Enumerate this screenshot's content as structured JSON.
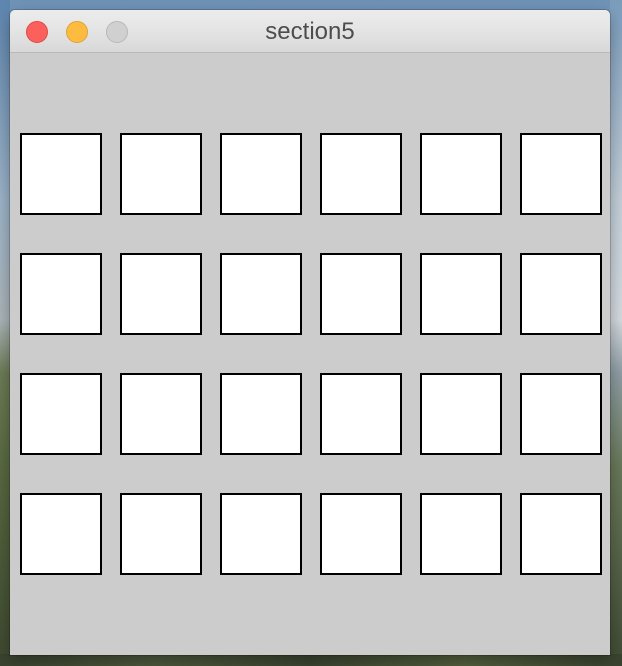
{
  "window": {
    "title": "section5",
    "controls": {
      "close_color": "#fc605c",
      "minimize_color": "#fdbc40",
      "zoom_color": "#d0d0d0"
    }
  },
  "content": {
    "background_color": "#cccccc",
    "grid": {
      "rows": 4,
      "columns": 6,
      "cell_fill": "#ffffff",
      "cell_border": "#000000"
    }
  }
}
